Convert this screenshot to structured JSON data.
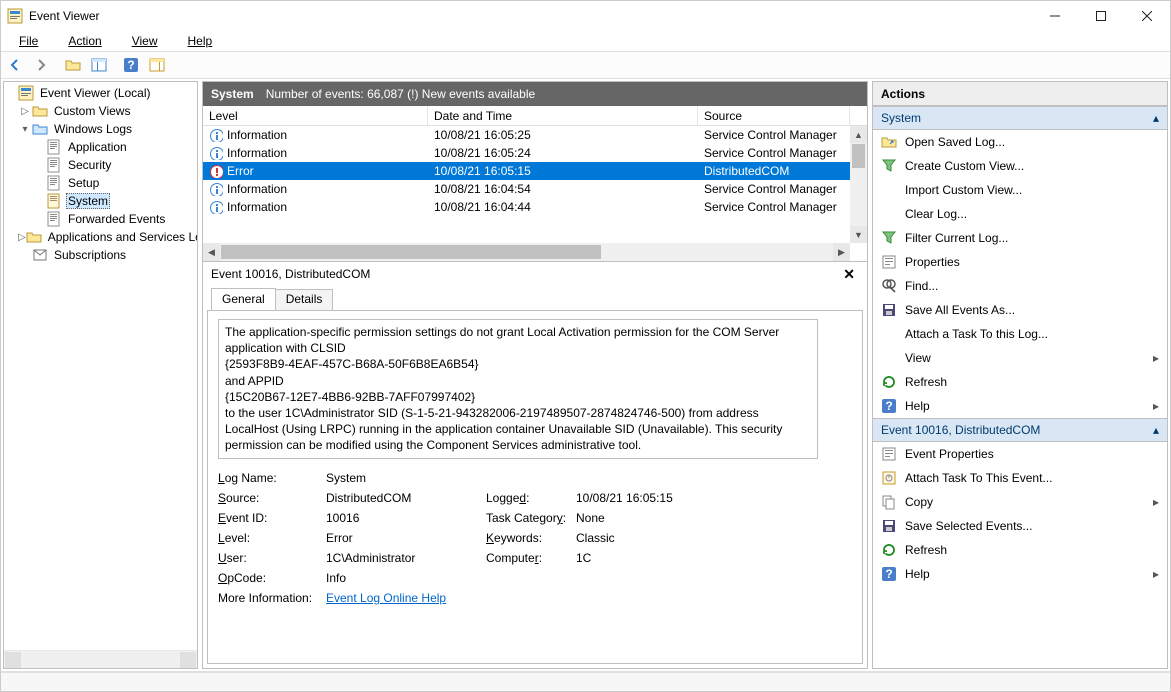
{
  "window": {
    "title": "Event Viewer"
  },
  "menu": {
    "file": "File",
    "action": "Action",
    "view": "View",
    "help": "Help"
  },
  "tree": {
    "root": "Event Viewer (Local)",
    "custom": "Custom Views",
    "winlogs": "Windows Logs",
    "app": "Application",
    "sec": "Security",
    "setup": "Setup",
    "system": "System",
    "forward": "Forwarded Events",
    "appsrv": "Applications and Services Lo",
    "subs": "Subscriptions"
  },
  "list": {
    "header_title": "System",
    "header_count": "Number of events: 66,087 (!) New events available",
    "col_level": "Level",
    "col_date": "Date and Time",
    "col_source": "Source",
    "rows": [
      {
        "level": "Information",
        "icon": "info",
        "date": "10/08/21 16:05:25",
        "source": "Service Control Manager",
        "sel": false
      },
      {
        "level": "Information",
        "icon": "info",
        "date": "10/08/21 16:05:24",
        "source": "Service Control Manager",
        "sel": false
      },
      {
        "level": "Error",
        "icon": "err",
        "date": "10/08/21 16:05:15",
        "source": "DistributedCOM",
        "sel": true
      },
      {
        "level": "Information",
        "icon": "info",
        "date": "10/08/21 16:04:54",
        "source": "Service Control Manager",
        "sel": false
      },
      {
        "level": "Information",
        "icon": "info",
        "date": "10/08/21 16:04:44",
        "source": "Service Control Manager",
        "sel": false
      }
    ]
  },
  "detail": {
    "title": "Event 10016, DistributedCOM",
    "tab_general": "General",
    "tab_details": "Details",
    "msg1": "The application-specific permission settings do not grant Local Activation permission for the COM Server application with CLSID",
    "msg2": "{2593F8B9-4EAF-457C-B68A-50F6B8EA6B54}",
    "msg3": " and APPID",
    "msg4": "{15C20B67-12E7-4BB6-92BB-7AFF07997402}",
    "msg5": " to the user 1C\\Administrator SID (S-1-5-21-943282006-2197489507-2874824746-500) from address LocalHost (Using LRPC) running in the application container Unavailable SID (Unavailable). This security permission can be modified using the Component Services administrative tool.",
    "k_log": "Log Name:",
    "v_log": "System",
    "k_src": "Source:",
    "v_src": "DistributedCOM",
    "k_eid": "Event ID:",
    "v_eid": "10016",
    "k_lvl": "Level:",
    "v_lvl": "Error",
    "k_usr": "User:",
    "v_usr": "1C\\Administrator",
    "k_opc": "OpCode:",
    "v_opc": "Info",
    "k_more": "More Information:",
    "k_logged": "Logged:",
    "v_logged": "10/08/21 16:05:15",
    "k_cat": "Task Category:",
    "v_cat": "None",
    "k_kw": "Keywords:",
    "v_kw": "Classic",
    "k_comp": "Computer:",
    "v_comp": "1C",
    "link": "Event Log Online Help"
  },
  "actions": {
    "title": "Actions",
    "sec1": "System",
    "open": "Open Saved Log...",
    "create": "Create Custom View...",
    "import": "Import Custom View...",
    "clear": "Clear Log...",
    "filter": "Filter Current Log...",
    "props": "Properties",
    "find": "Find...",
    "saveall": "Save All Events As...",
    "attach": "Attach a Task To this Log...",
    "view": "View",
    "refresh": "Refresh",
    "help": "Help",
    "sec2": "Event 10016, DistributedCOM",
    "evprops": "Event Properties",
    "evattach": "Attach Task To This Event...",
    "copy": "Copy",
    "savesel": "Save Selected Events...",
    "refresh2": "Refresh",
    "help2": "Help"
  }
}
